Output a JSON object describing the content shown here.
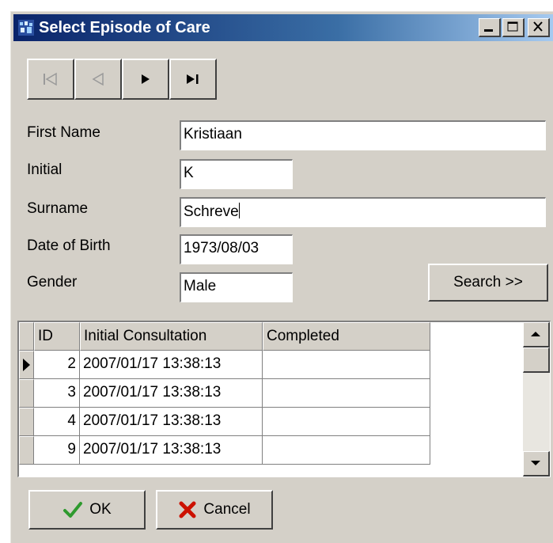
{
  "window": {
    "title": "Select Episode of Care"
  },
  "nav": {
    "first": "first-record",
    "prev": "previous-record",
    "next": "next-record",
    "last": "last-record"
  },
  "form": {
    "first_name_label": "First Name",
    "first_name_value": "Kristiaan",
    "initial_label": "Initial",
    "initial_value": "K",
    "surname_label": "Surname",
    "surname_value": "Schreve",
    "dob_label": "Date of Birth",
    "dob_value": "1973/08/03",
    "gender_label": "Gender",
    "gender_value": "Male",
    "search_label": "Search >>"
  },
  "grid": {
    "columns": [
      "ID",
      "Initial Consultation",
      "Completed"
    ],
    "rows": [
      {
        "id": "2",
        "initial": "2007/01/17 13:38:13",
        "completed": ""
      },
      {
        "id": "3",
        "initial": "2007/01/17 13:38:13",
        "completed": ""
      },
      {
        "id": "4",
        "initial": "2007/01/17 13:38:13",
        "completed": ""
      },
      {
        "id": "9",
        "initial": "2007/01/17 13:38:13",
        "completed": ""
      }
    ]
  },
  "footer": {
    "ok_label": "OK",
    "cancel_label": "Cancel"
  },
  "colors": {
    "titlebar_start": "#0a246a",
    "titlebar_end": "#a6caf0",
    "face": "#d4d0c8",
    "ok_check": "#2e9a2e",
    "cancel_x": "#cc1100"
  }
}
